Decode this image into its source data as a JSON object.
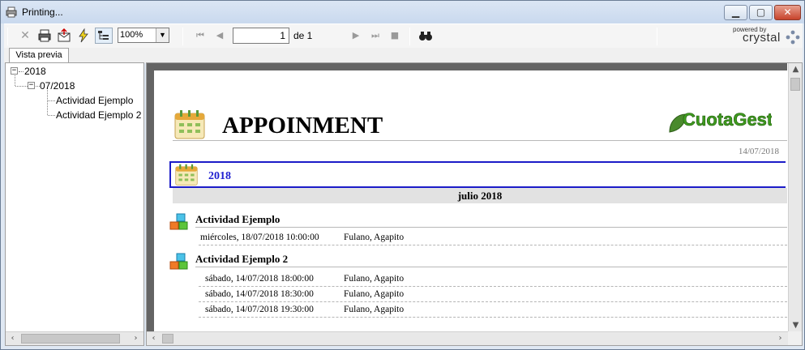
{
  "window": {
    "title": "Printing..."
  },
  "toolbar": {
    "zoom_value": "100%",
    "page_current": "1",
    "page_of": "de 1",
    "powered_by": "powered by",
    "brand": "crystal"
  },
  "tabs": [
    {
      "label": "Vista previa"
    }
  ],
  "tree": {
    "year": "2018",
    "month": "07/2018",
    "items": [
      "Actividad Ejemplo",
      "Actividad Ejemplo 2"
    ]
  },
  "report": {
    "title": "APPOINMENT",
    "logo_text": "CuotaGest",
    "date": "14/07/2018",
    "year": "2018",
    "month": "julio 2018",
    "activities": [
      {
        "name": "Actividad Ejemplo",
        "rows": [
          {
            "when": "miércoles, 18/07/2018  10:00:00",
            "who": "Fulano, Agapito"
          }
        ]
      },
      {
        "name": "Actividad Ejemplo 2",
        "rows": [
          {
            "when": "sábado, 14/07/2018  18:00:00",
            "who": "Fulano, Agapito"
          },
          {
            "when": "sábado, 14/07/2018  18:30:00",
            "who": "Fulano, Agapito"
          },
          {
            "when": "sábado, 14/07/2018  19:30:00",
            "who": "Fulano, Agapito"
          }
        ]
      }
    ]
  },
  "colors": {
    "accent": "#1c1cc8",
    "band": "#e2e2e2",
    "logo_green": "#3f9b1f"
  },
  "icons": [
    "printer-icon",
    "close-report-icon",
    "print-icon",
    "export-icon",
    "refresh-icon",
    "group-tree-icon",
    "first-page-icon",
    "prev-page-icon",
    "next-page-icon",
    "last-page-icon",
    "stop-icon",
    "search-icon",
    "calendar-icon",
    "cubes-icon"
  ]
}
